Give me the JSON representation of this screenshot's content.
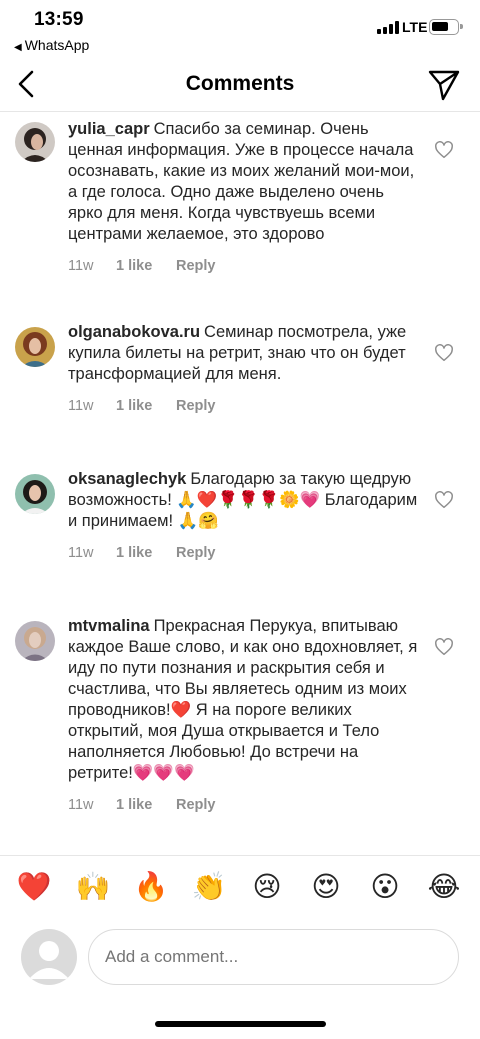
{
  "status_bar": {
    "time": "13:59",
    "back_app": "WhatsApp",
    "network": "LTE"
  },
  "header": {
    "title": "Comments"
  },
  "comments": [
    {
      "username": "yulia_capr",
      "text": "Спасибо за семинар. Очень ценная информация. Уже в процессе начала осознавать, какие из моих желаний мои-мои, а где голоса. Одно даже выделено очень ярко для меня. Когда чувствуешь всеми центрами желаемое, это здорово",
      "time": "11w",
      "likes": "1 like",
      "reply": "Reply"
    },
    {
      "username": "olganabokova.ru",
      "text": "Семинар посмотрела, уже купила билеты на ретрит, знаю что он будет трансформацией для меня.",
      "time": "11w",
      "likes": "1 like",
      "reply": "Reply"
    },
    {
      "username": "oksanaglechyk",
      "text": "Благодарю за такую щедрую возможность! 🙏❤️🌹🌹🌹🌼💗 Благодарим и принимаем! 🙏🤗",
      "time": "11w",
      "likes": "1 like",
      "reply": "Reply"
    },
    {
      "username": "mtvmalina",
      "text": "Прекрасная Перукуа, впитываю каждое Ваше слово, и как оно вдохновляет, я иду по пути познания и раскрытия себя и счастлива, что Вы являетесь одним из моих проводников!❤️ Я на пороге великих открытий, моя Душа открывается и Тело наполняется Любовью! До встречи на ретрите!💗💗💗",
      "time": "11w",
      "likes": "1 like",
      "reply": "Reply"
    }
  ],
  "quick_reactions": [
    "❤️",
    "🙌",
    "🔥",
    "👏",
    "😢",
    "😍",
    "😮",
    "😂"
  ],
  "reaction_names": [
    "red-heart-emoji",
    "raised-hands-emoji",
    "fire-emoji",
    "clapping-hands-emoji",
    "crying-face-emoji",
    "heart-eyes-emoji",
    "surprised-face-emoji",
    "tears-of-joy-emoji"
  ],
  "input": {
    "placeholder": "Add a comment..."
  }
}
